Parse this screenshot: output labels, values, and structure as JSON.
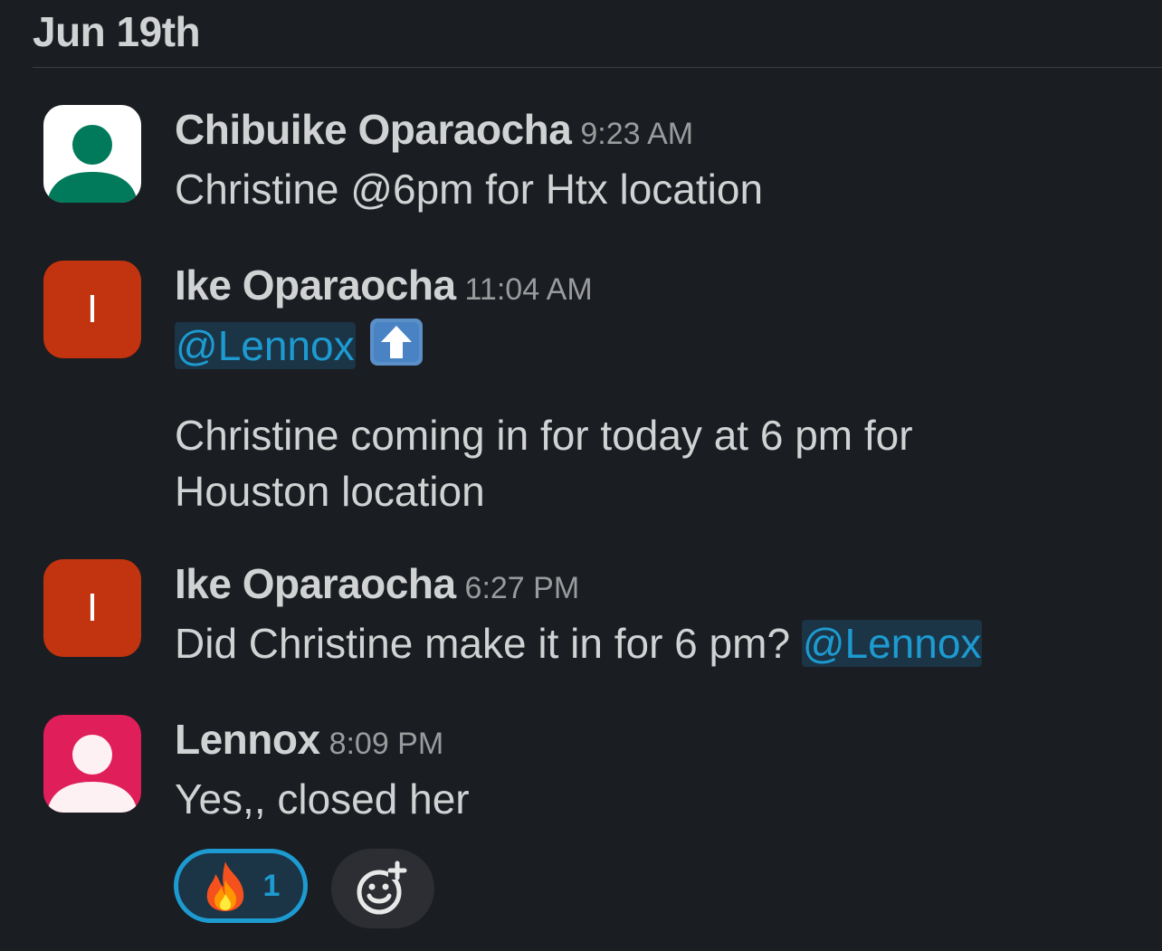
{
  "date_header": "Jun 19th",
  "messages": [
    {
      "author": "Chibuike Oparaocha",
      "time": "9:23 AM",
      "avatar": {
        "type": "person-icon",
        "bg": "#ffffff",
        "fg": "#007a5a"
      },
      "text": "Christine @6pm for Htx location"
    },
    {
      "author": "Ike Oparaocha",
      "time": "11:04 AM",
      "avatar": {
        "type": "letter",
        "letter": "I",
        "bg": "#c2330f"
      },
      "mention": "@Lennox",
      "emoji": "arrow-up-emoji",
      "text_line1": "Christine coming in for today at 6 pm for",
      "text_line2": "Houston location"
    },
    {
      "author": "Ike Oparaocha",
      "time": "6:27 PM",
      "avatar": {
        "type": "letter",
        "letter": "I",
        "bg": "#c2330f"
      },
      "text": "Did Christine make it in for 6 pm?",
      "mention": "@Lennox"
    },
    {
      "author": "Lennox",
      "time": "8:09 PM",
      "avatar": {
        "type": "person-icon",
        "bg": "#e01e5a",
        "fg": "#fdf1f4"
      },
      "text": "Yes,, closed her",
      "reactions": [
        {
          "emoji": "fire-emoji",
          "count": "1",
          "selected": true
        }
      ]
    }
  ],
  "colors": {
    "background": "#1a1d21",
    "text": "#d1d2d3",
    "timestamp": "#9a9b9d",
    "mention": "#1d9bd1",
    "mention_bg": "#1b3446"
  }
}
